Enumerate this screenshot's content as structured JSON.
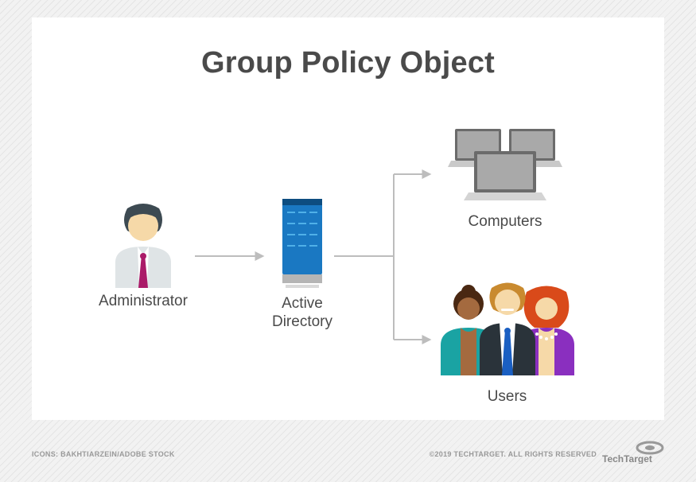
{
  "title": "Group Policy Object",
  "nodes": {
    "administrator": "Administrator",
    "active_directory": "Active\nDirectory",
    "computers": "Computers",
    "users": "Users"
  },
  "credit": "ICONS: BAKHTIARZEIN/ADOBE STOCK",
  "copyright": "©2019 TECHTARGET. ALL RIGHTS RESERVED",
  "logo_text": "TechTarget"
}
